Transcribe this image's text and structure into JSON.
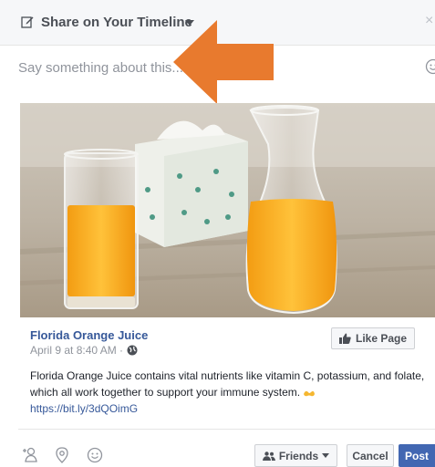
{
  "dialog": {
    "title": "Share on Your Timeline",
    "close_label": "×"
  },
  "composer": {
    "placeholder": "Say something about this..."
  },
  "attachment": {
    "page_name": "Florida Orange Juice",
    "timestamp": "April 9 at 8:40 AM · ",
    "like_button_label": "Like Page",
    "body_text": "Florida Orange Juice contains vital nutrients like vitamin C, potassium, and folate, which all work together to support your immune system. ",
    "link_text": "https://bit.ly/3dQOimG"
  },
  "footer": {
    "audience_label": "Friends",
    "cancel_label": "Cancel",
    "post_label": "Post"
  },
  "colors": {
    "brand": "#4267b2",
    "link": "#365899",
    "arrow": "#e87a2e",
    "juice": "#f5a623"
  },
  "icons": [
    "edit-icon",
    "caret-down-icon",
    "close-icon",
    "emoji-icon",
    "globe-icon",
    "thumbs-up-icon",
    "flex-emoji-icon",
    "tag-friends-icon",
    "location-icon",
    "feeling-icon",
    "friends-icon"
  ]
}
